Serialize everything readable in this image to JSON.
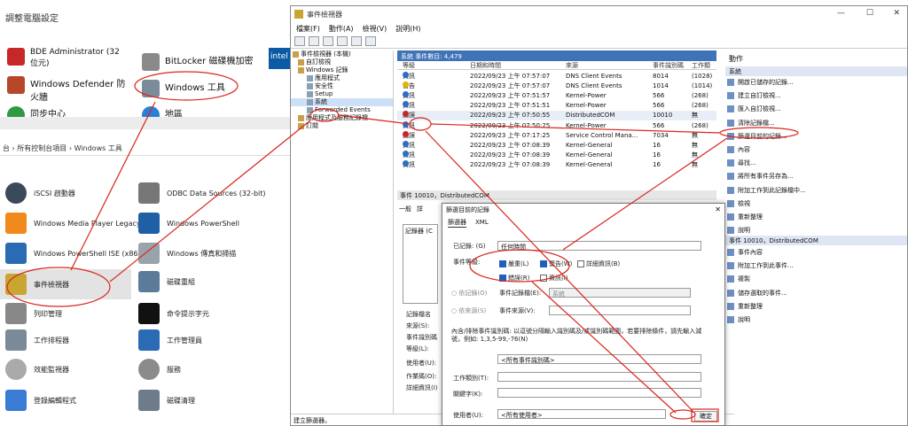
{
  "control_panel": {
    "title": "調整電腦設定",
    "items": [
      {
        "label": "BDE Administrator (32 位元)",
        "icon": "bde-icon"
      },
      {
        "label": "BitLocker 磁碟機加密",
        "icon": "bitlocker-icon"
      },
      {
        "label": "Windows Defender 防火牆",
        "icon": "firewall-icon"
      },
      {
        "label": "Windows 工具",
        "icon": "windows-tools-icon"
      },
      {
        "label": "同步中心",
        "icon": "sync-icon"
      },
      {
        "label": "地區",
        "icon": "region-icon"
      }
    ],
    "breadcrumb": "台 › 所有控制台項目 › Windows 工具",
    "tools": [
      {
        "label": "iSCSI 啟動器"
      },
      {
        "label": "ODBC Data Sources (32-bit)"
      },
      {
        "label": "Windows Media Player Legacy"
      },
      {
        "label": "Windows PowerShell"
      },
      {
        "label": "Windows PowerShell ISE (x86)"
      },
      {
        "label": "Windows 傳真和掃描"
      },
      {
        "label": "事件檢視器"
      },
      {
        "label": "磁碟重組"
      },
      {
        "label": "列印管理"
      },
      {
        "label": "命令提示字元"
      },
      {
        "label": "工作排程器"
      },
      {
        "label": "工作管理員"
      },
      {
        "label": "效能監視器"
      },
      {
        "label": "服務"
      },
      {
        "label": "登錄編輯程式"
      },
      {
        "label": "磁碟清理"
      }
    ]
  },
  "event_viewer": {
    "title": "事件檢視器",
    "menu": [
      "檔案(F)",
      "動作(A)",
      "檢視(V)",
      "說明(H)"
    ],
    "tree": [
      "事件檢視器 (本機)",
      "自訂檢視",
      "Windows 記錄",
      "應用程式",
      "安全性",
      "Setup",
      "系統",
      "Forwarded Events",
      "應用程式及服務記錄檔",
      "訂閱"
    ],
    "list_header": "系統   事件數目: 4,479",
    "columns": [
      "等級",
      "日期和時間",
      "來源",
      "事件識別碼",
      "工作類"
    ],
    "rows": [
      {
        "level": "資訊",
        "date": "2022/09/23 上午 07:57:07",
        "source": "DNS Client Events",
        "id": "8014",
        "task": "(1028)",
        "kind": "info"
      },
      {
        "level": "警告",
        "date": "2022/09/23 上午 07:57:07",
        "source": "DNS Client Events",
        "id": "1014",
        "task": "(1014)",
        "kind": "warn"
      },
      {
        "level": "資訊",
        "date": "2022/09/23 上午 07:51:57",
        "source": "Kernel-Power",
        "id": "566",
        "task": "(268)",
        "kind": "info"
      },
      {
        "level": "資訊",
        "date": "2022/09/23 上午 07:51:51",
        "source": "Kernel-Power",
        "id": "566",
        "task": "(268)",
        "kind": "info"
      },
      {
        "level": "錯誤",
        "date": "2022/09/23 上午 07:50:55",
        "source": "DistributedCOM",
        "id": "10010",
        "task": "無",
        "kind": "error"
      },
      {
        "level": "資訊",
        "date": "2022/09/23 上午 07:50:25",
        "source": "Kernel-Power",
        "id": "566",
        "task": "(268)",
        "kind": "info"
      },
      {
        "level": "錯誤",
        "date": "2022/09/23 上午 07:17:25",
        "source": "Service Control Mana...",
        "id": "7034",
        "task": "無",
        "kind": "error"
      },
      {
        "level": "資訊",
        "date": "2022/09/23 上午 07:08:39",
        "source": "Kernel-General",
        "id": "16",
        "task": "無",
        "kind": "info"
      },
      {
        "level": "資訊",
        "date": "2022/09/23 上午 07:08:39",
        "source": "Kernel-General",
        "id": "16",
        "task": "無",
        "kind": "info"
      },
      {
        "level": "資訊",
        "date": "2022/09/23 上午 07:08:39",
        "source": "Kernel-General",
        "id": "16",
        "task": "無",
        "kind": "info"
      }
    ],
    "detail_header": "事件 10010，DistributedCOM",
    "detail_tabs": [
      "一般",
      "詳"
    ],
    "detail_box": "記錄器 (C",
    "detail_labels": [
      "記錄檔名",
      "來源(S):",
      "事件識別碼",
      "等級(L):",
      "使用者(U):",
      "作業碼(O):",
      "詳細資訊(I)"
    ],
    "status": "建立篩選器。",
    "actions": {
      "header": "動作",
      "section1": "系統",
      "items1": [
        "開啟已儲存的記錄...",
        "建立自訂檢視...",
        "匯入自訂檢視...",
        "清除記錄檔...",
        "篩選目前的記錄...",
        "內容",
        "尋找...",
        "將所有事件另存為...",
        "附加工作到此記錄檔中...",
        "檢視",
        "重新整理",
        "說明"
      ],
      "section2": "事件 10010，DistributedCOM",
      "items2": [
        "事件內容",
        "附加工作到此事件...",
        "複製",
        "儲存選取的事件...",
        "重新整理",
        "說明"
      ]
    }
  },
  "filter_dialog": {
    "title": "篩選目前的記錄",
    "tabs": [
      "篩選器",
      "XML"
    ],
    "logged_label": "已記錄: (G)",
    "logged_value": "任何時間",
    "level_label": "事件等級:",
    "levels": [
      {
        "label": "嚴重(L)",
        "checked": true
      },
      {
        "label": "警告(W)",
        "checked": true
      },
      {
        "label": "詳細資訊(B)",
        "checked": false
      },
      {
        "label": "錯誤(R)",
        "checked": true
      },
      {
        "label": "資訊(I)",
        "checked": false
      }
    ],
    "by_log": "依記錄(O)",
    "log_label": "事件記錄檔(E):",
    "log_value": "系統",
    "by_source": "依來源(S)",
    "source_label": "事件來源(V):",
    "hint": "內含/排除事件識別碼: 以逗號分隔輸入識別碼及/或識別碼範圍，若要排除條件，請先輸入減號，例如: 1,3,5-99,-76(N)",
    "id_placeholder": "<所有事件識別碼>",
    "task_label": "工作類別(T):",
    "keyword_label": "關鍵字(K):",
    "user_label": "使用者(U):",
    "user_value": "<所有使用者>",
    "ok_label": "確定"
  },
  "colors": {
    "annotation": "#d9261c",
    "selection": "#3f73b8"
  }
}
